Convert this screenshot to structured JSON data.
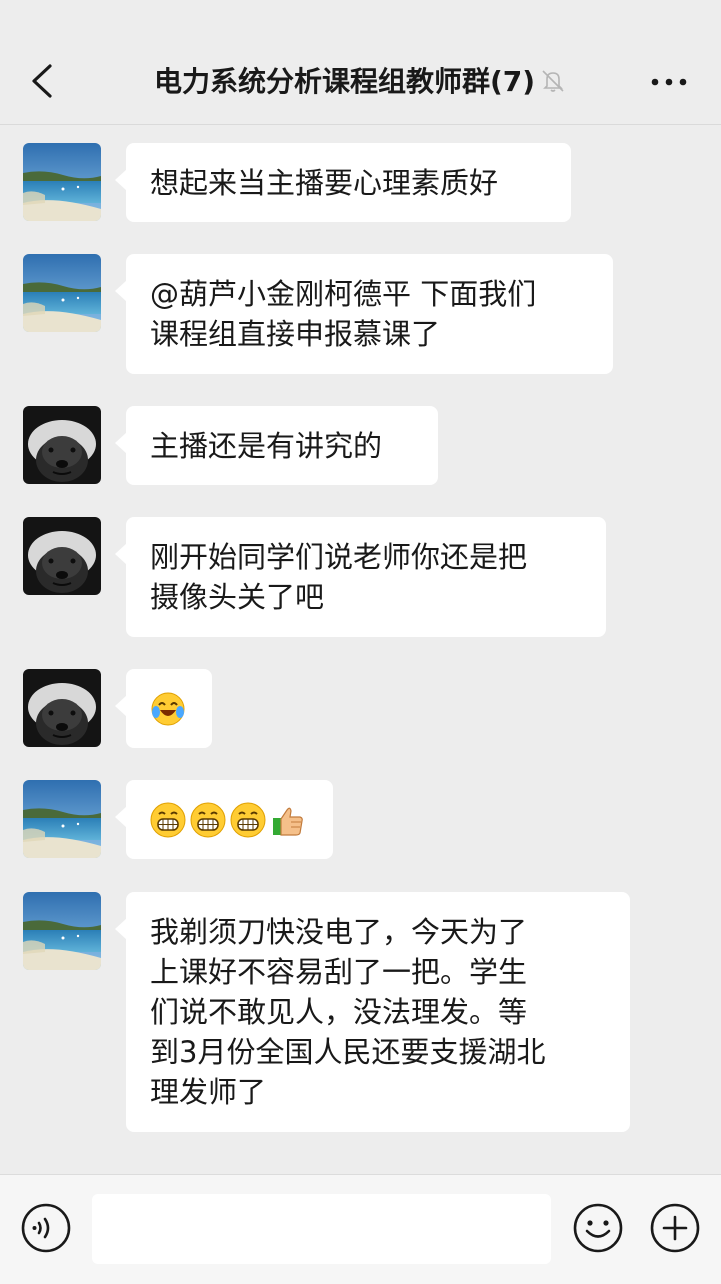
{
  "header": {
    "title": "电力系统分析课程组教师群(7)",
    "back_icon": "chevron-left-icon",
    "mute_icon": "bell-muted-icon",
    "more_icon": "more-dots-icon"
  },
  "messages": [
    {
      "avatar": "landscape-avatar",
      "text": "想起来当主播要心理素质好"
    },
    {
      "avatar": "landscape-avatar",
      "lines": [
        "@葫芦小金刚柯德平 下面我们",
        "课程组直接申报慕课了"
      ]
    },
    {
      "avatar": "badger-avatar",
      "text": "主播还是有讲究的"
    },
    {
      "avatar": "badger-avatar",
      "lines": [
        "刚开始同学们说老师你还是把",
        "摄像头关了吧"
      ]
    },
    {
      "avatar": "badger-avatar",
      "emojis": [
        "laugh-cry-emoji"
      ]
    },
    {
      "avatar": "landscape-avatar",
      "emojis": [
        "grin-emoji",
        "grin-emoji",
        "grin-emoji",
        "thumbs-up-emoji"
      ]
    },
    {
      "avatar": "landscape-avatar",
      "lines": [
        "我剃须刀快没电了，今天为了",
        "上课好不容易刮了一把。学生",
        "们说不敢见人，没法理发。等",
        "到3月份全国人民还要支援湖北",
        "理发师了"
      ]
    }
  ],
  "inputbar": {
    "voice_icon": "voice-icon",
    "input_value": "",
    "emoji_icon": "smiley-icon",
    "plus_icon": "plus-circle-icon"
  },
  "colors": {
    "background": "#ededed",
    "bubble": "#ffffff",
    "text": "#191919",
    "inputbar": "#f6f6f6"
  }
}
